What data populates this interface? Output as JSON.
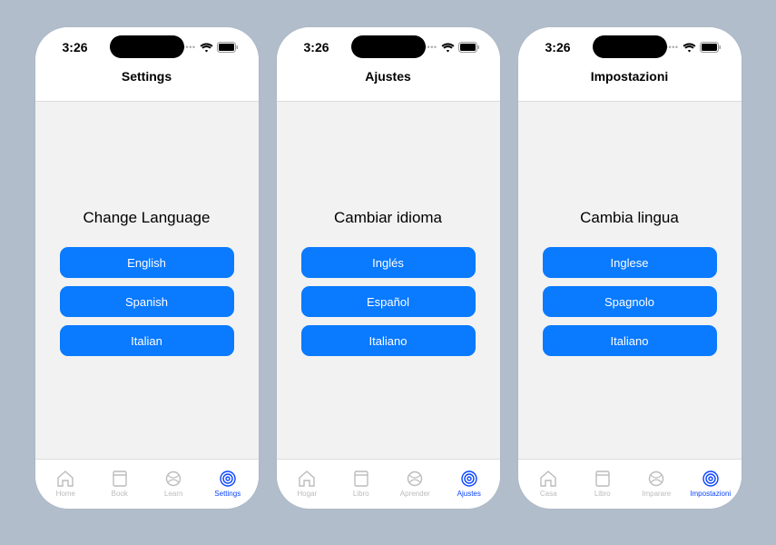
{
  "status": {
    "time": "3:26"
  },
  "accent": "#0a7aff",
  "phones": [
    {
      "navTitle": "Settings",
      "heading": "Change Language",
      "buttons": [
        "English",
        "Spanish",
        "Italian"
      ],
      "tabs": [
        "Home",
        "Book",
        "Learn",
        "Settings"
      ]
    },
    {
      "navTitle": "Ajustes",
      "heading": "Cambiar idioma",
      "buttons": [
        "Inglés",
        "Español",
        "Italiano"
      ],
      "tabs": [
        "Hogar",
        "Libro",
        "Aprender",
        "Ajustes"
      ]
    },
    {
      "navTitle": "Impostazioni",
      "heading": "Cambia lingua",
      "buttons": [
        "Inglese",
        "Spagnolo",
        "Italiano"
      ],
      "tabs": [
        "Casa",
        "Libro",
        "Imparare",
        "Impostazioni"
      ]
    }
  ]
}
